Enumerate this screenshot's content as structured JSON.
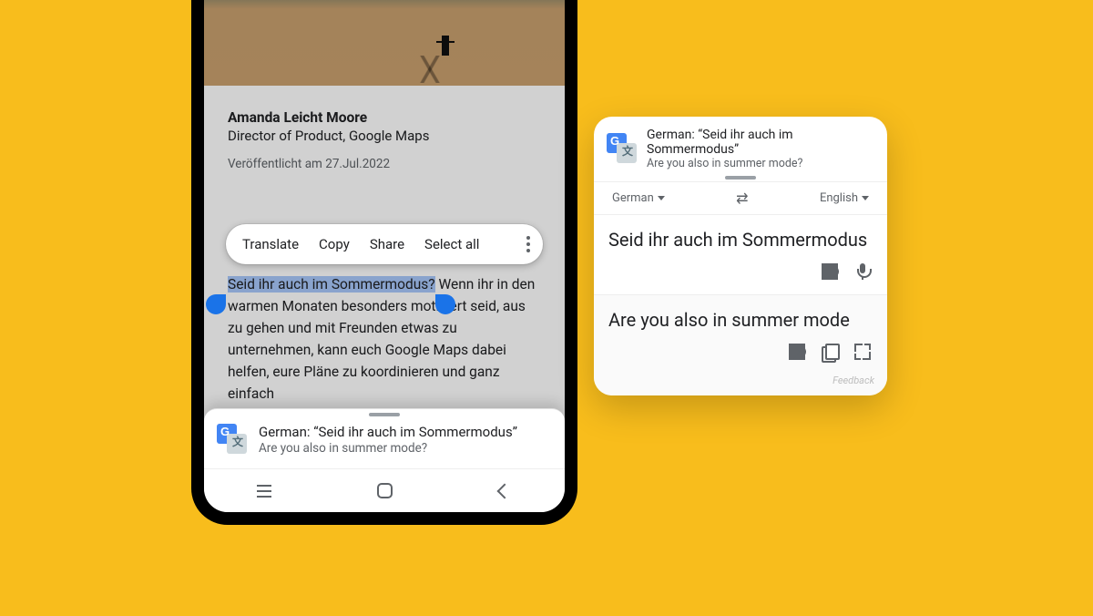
{
  "article": {
    "author_name": "Amanda Leicht Moore",
    "author_role": "Director of Product, Google Maps",
    "published": "Veröffentlicht am 27.Jul.2022",
    "selected_text": "Seid ihr auch im Sommermodus?",
    "body_rest": " Wenn ihr in den warmen Monaten besonders motiviert seid, aus zu gehen und mit Freunden etwas zu unternehmen, kann euch Google Maps dabei helfen, eure Pläne zu koordinieren und ganz einfach"
  },
  "toolbar": {
    "translate": "Translate",
    "copy": "Copy",
    "share": "Share",
    "select_all": "Select all"
  },
  "banner": {
    "title": "German: “Seid ihr auch im Sommermodus”",
    "subtitle": "Are you also in summer mode?"
  },
  "card": {
    "head_title": "German: “Seid ihr auch im Sommermodus”",
    "head_sub": "Are you also in summer mode?",
    "src_lang": "German",
    "dst_lang": "English",
    "swap": "⇄",
    "src_text": "Seid ihr auch im Sommermodus",
    "dst_text": "Are you also in summer mode",
    "feedback": "Feedback"
  }
}
